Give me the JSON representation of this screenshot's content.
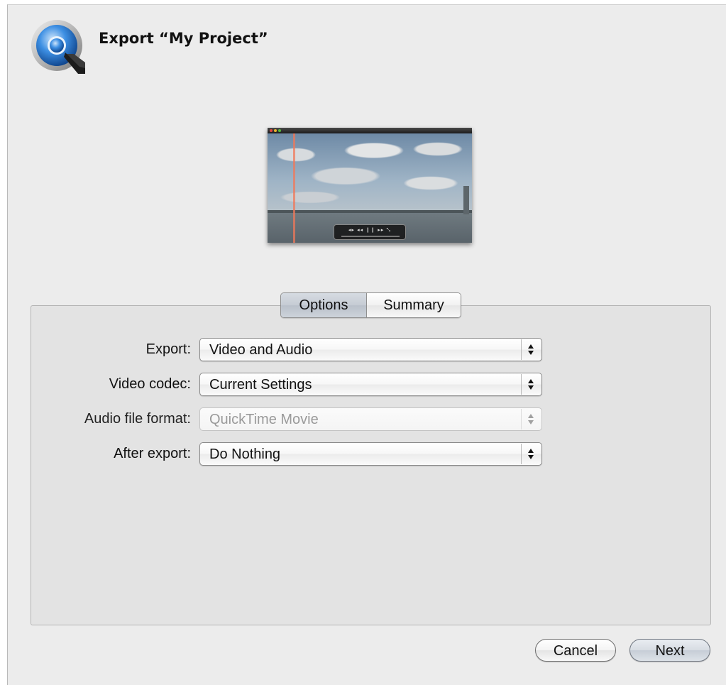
{
  "window": {
    "title": "Export “My Project”"
  },
  "preview": {
    "controls_glyphs": "◂▸  ◂◂ ❙❙ ▸▸   ⤡"
  },
  "tabs": [
    {
      "label": "Options",
      "selected": true
    },
    {
      "label": "Summary",
      "selected": false
    }
  ],
  "form": {
    "export": {
      "label": "Export:",
      "value": "Video and Audio",
      "enabled": true
    },
    "video_codec": {
      "label": "Video codec:",
      "value": "Current Settings",
      "enabled": true
    },
    "audio_file_format": {
      "label": "Audio file format:",
      "value": "QuickTime Movie",
      "enabled": false
    },
    "after_export": {
      "label": "After export:",
      "value": "Do Nothing",
      "enabled": true
    }
  },
  "buttons": {
    "cancel": "Cancel",
    "next": "Next"
  },
  "icons": {
    "app": "quicktime-icon"
  },
  "colors": {
    "sheet_bg": "#ececec",
    "panel_bg": "#e3e3e3",
    "disabled_text": "#9a9a9a"
  }
}
